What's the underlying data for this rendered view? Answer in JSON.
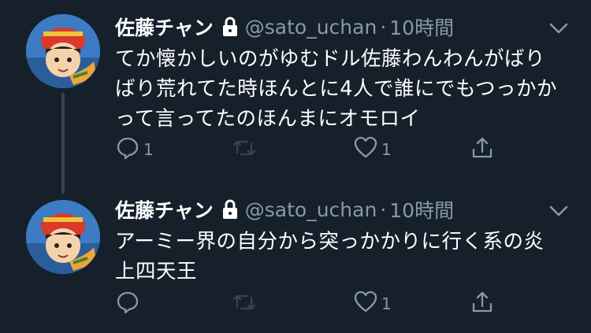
{
  "colors": {
    "background": "#15202b",
    "secondary_text": "#8899a6",
    "thread_line": "#38444d",
    "primary_text": "#ffffff"
  },
  "tweets": [
    {
      "author_name": "佐藤チャン",
      "handle": "@sato_uchan",
      "separator": "·",
      "time": "10時間",
      "protected_icon": "lock-icon",
      "text_lines": [
        "てか懐かしいのがゆむドル佐藤わんわんがばり",
        "ばり荒れてた時ほんとに4人で誰にでもつっかか",
        "って言ってたのほんまにオモロイ"
      ],
      "reply_count": "1",
      "retweet_count": "",
      "like_count": "1"
    },
    {
      "author_name": "佐藤チャン",
      "handle": "@sato_uchan",
      "separator": "·",
      "time": "10時間",
      "protected_icon": "lock-icon",
      "text_lines": [
        "アーミー界の自分から突っかかりに行く系の炎",
        "上四天王"
      ],
      "reply_count": "",
      "retweet_count": "",
      "like_count": "1"
    }
  ],
  "icons": {
    "reply": "reply-icon",
    "retweet": "retweet-icon",
    "like": "heart-icon",
    "share": "share-icon",
    "menu": "chevron-down-icon"
  }
}
